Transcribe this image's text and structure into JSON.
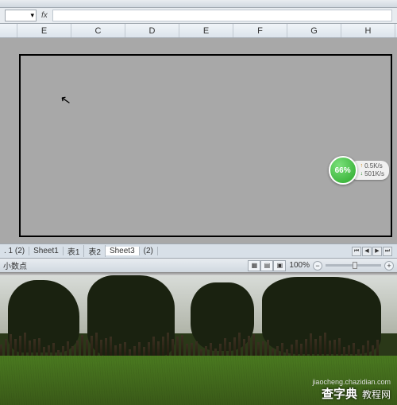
{
  "formula_bar": {
    "fx_label": "fx"
  },
  "columns": [
    "",
    "E",
    "C",
    "D",
    "E",
    "F",
    "G",
    "H"
  ],
  "net_widget": {
    "percent": "66%",
    "up": "0.5K/s",
    "down": "501K/s"
  },
  "sheet_tabs": [
    {
      "label": ". 1 (2)",
      "active": false
    },
    {
      "label": "Sheet1",
      "active": false
    },
    {
      "label": "表1",
      "active": false
    },
    {
      "label": "表2",
      "active": false
    },
    {
      "label": "Sheet3",
      "active": true
    },
    {
      "label": "(2)",
      "active": false
    }
  ],
  "status": {
    "left": "小数点",
    "zoom": "100%"
  },
  "watermark": {
    "brand": "查字典",
    "suffix": "教程网",
    "url": "jiaocheng.chazidian.com"
  }
}
